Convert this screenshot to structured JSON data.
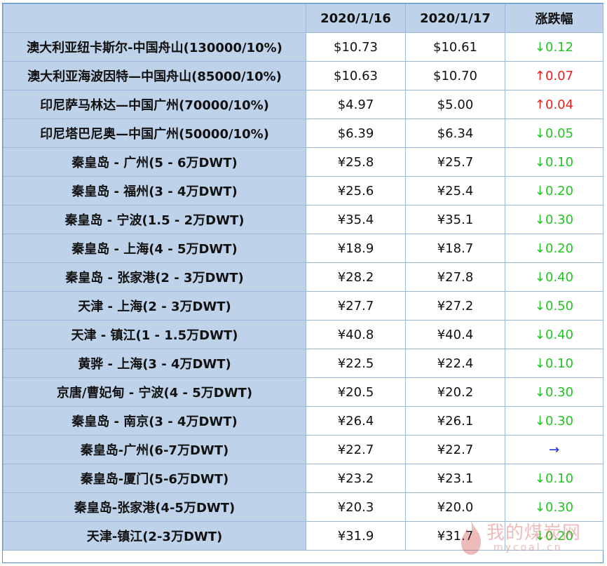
{
  "header": {
    "route": "",
    "date1": "2020/1/16",
    "date2": "2020/1/17",
    "change": "涨跌幅"
  },
  "rows": [
    {
      "route": "澳大利亚纽卡斯尔-中国舟山(130000/10%)",
      "p1": "$10.73",
      "p2": "$10.61",
      "chg": "↓0.12",
      "dir": "down"
    },
    {
      "route": "澳大利亚海波因特—中国舟山(85000/10%)",
      "p1": "$10.63",
      "p2": "$10.70",
      "chg": "↑0.07",
      "dir": "up"
    },
    {
      "route": "印尼萨马林达—中国广州(70000/10%)",
      "p1": "$4.97",
      "p2": "$5.00",
      "chg": "↑0.04",
      "dir": "up"
    },
    {
      "route": "印尼塔巴尼奥—中国广州(50000/10%)",
      "p1": "$6.39",
      "p2": "$6.34",
      "chg": "↓0.05",
      "dir": "down"
    },
    {
      "route": "秦皇岛 - 广州(5 - 6万DWT)",
      "p1": "¥25.8",
      "p2": "¥25.7",
      "chg": "↓0.10",
      "dir": "down"
    },
    {
      "route": "秦皇岛 - 福州(3 - 4万DWT)",
      "p1": "¥25.6",
      "p2": "¥25.4",
      "chg": "↓0.20",
      "dir": "down"
    },
    {
      "route": "秦皇岛 - 宁波(1.5 - 2万DWT)",
      "p1": "¥35.4",
      "p2": "¥35.1",
      "chg": "↓0.30",
      "dir": "down"
    },
    {
      "route": "秦皇岛 - 上海(4 - 5万DWT)",
      "p1": "¥18.9",
      "p2": "¥18.7",
      "chg": "↓0.20",
      "dir": "down"
    },
    {
      "route": "秦皇岛 - 张家港(2 - 3万DWT)",
      "p1": "¥28.2",
      "p2": "¥27.8",
      "chg": "↓0.40",
      "dir": "down"
    },
    {
      "route": "天津 - 上海(2 - 3万DWT)",
      "p1": "¥27.7",
      "p2": "¥27.2",
      "chg": "↓0.50",
      "dir": "down"
    },
    {
      "route": "天津 - 镇江(1 - 1.5万DWT)",
      "p1": "¥40.8",
      "p2": "¥40.4",
      "chg": "↓0.40",
      "dir": "down"
    },
    {
      "route": "黄骅 - 上海(3 - 4万DWT)",
      "p1": "¥22.5",
      "p2": "¥22.4",
      "chg": "↓0.10",
      "dir": "down"
    },
    {
      "route": "京唐/曹妃甸 - 宁波(4 - 5万DWT)",
      "p1": "¥20.5",
      "p2": "¥20.2",
      "chg": "↓0.30",
      "dir": "down"
    },
    {
      "route": "秦皇岛 - 南京(3 - 4万DWT)",
      "p1": "¥26.4",
      "p2": "¥26.1",
      "chg": "↓0.30",
      "dir": "down"
    },
    {
      "route": "秦皇岛-广州(6-7万DWT)",
      "p1": "¥22.7",
      "p2": "¥22.7",
      "chg": "→",
      "dir": "flat"
    },
    {
      "route": "秦皇岛-厦门(5-6万DWT)",
      "p1": "¥23.2",
      "p2": "¥23.1",
      "chg": "↓0.10",
      "dir": "down"
    },
    {
      "route": "秦皇岛-张家港(4-5万DWT)",
      "p1": "¥20.3",
      "p2": "¥20.0",
      "chg": "↓0.30",
      "dir": "down"
    },
    {
      "route": "天津-镇江(2-3万DWT)",
      "p1": "¥31.9",
      "p2": "¥31.7",
      "chg": "↓0.20",
      "dir": "down"
    }
  ],
  "colors": {
    "header_bg": "#bed2ea",
    "border": "#9bb8dc",
    "down": "#22c522",
    "up": "#e8201c",
    "flat": "#1a2fd6"
  },
  "watermark": {
    "cn": "我的煤炭网",
    "en": "mycoal.cn"
  }
}
